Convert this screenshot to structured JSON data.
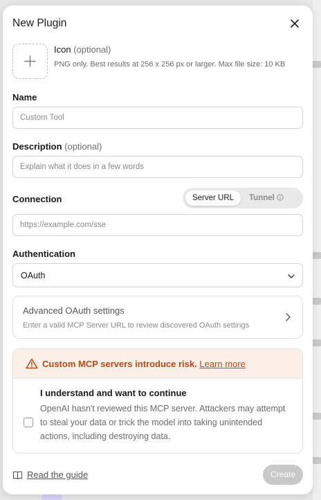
{
  "dialog": {
    "title": "New Plugin"
  },
  "icon": {
    "label": "Icon",
    "optional": "(optional)",
    "description": "PNG only. Best results at 256 x 256 px or larger. Max file size: 10 KB"
  },
  "name": {
    "label": "Name",
    "placeholder": "Custom Tool"
  },
  "description": {
    "label": "Description",
    "optional": "(optional)",
    "placeholder": "Explain what it does in a few words"
  },
  "connection": {
    "label": "Connection",
    "options": [
      "Server URL",
      "Tunnel"
    ],
    "selected": "Server URL",
    "placeholder": "https://example.com/sse"
  },
  "authentication": {
    "label": "Authentication",
    "value": "OAuth"
  },
  "advanced": {
    "title": "Advanced OAuth settings",
    "subtitle": "Enter a valid MCP Server URL to review discovered OAuth settings"
  },
  "risk": {
    "warning": "Custom MCP servers introduce risk.",
    "link": "Learn more",
    "consent_title": "I understand and want to continue",
    "consent_description": "OpenAI hasn't reviewed this MCP server. Attackers may attempt to steal your data or trick the model into taking unintended actions, including destroying data.",
    "checked": false
  },
  "footer": {
    "guide": "Read the guide",
    "create": "Create"
  },
  "colors": {
    "warning_text": "#b34a15",
    "warning_bg": "#fbf0e8",
    "create_disabled": "#c8c8c8"
  }
}
